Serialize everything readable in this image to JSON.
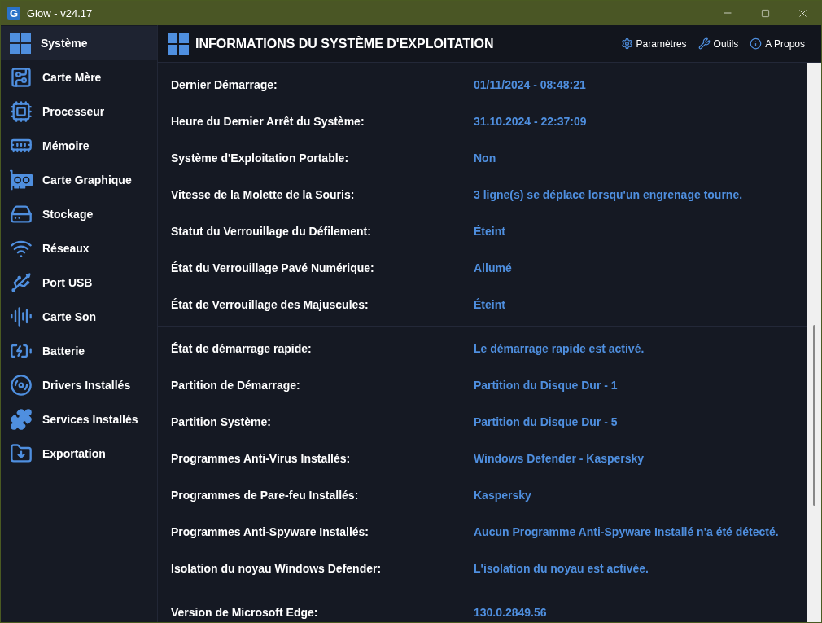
{
  "window": {
    "title": "Glow - v24.17",
    "logo": "G"
  },
  "sidebar": {
    "items": [
      {
        "label": "Système",
        "selected": true
      },
      {
        "label": "Carte Mère",
        "selected": false
      },
      {
        "label": "Processeur",
        "selected": false
      },
      {
        "label": "Mémoire",
        "selected": false
      },
      {
        "label": "Carte Graphique",
        "selected": false
      },
      {
        "label": "Stockage",
        "selected": false
      },
      {
        "label": "Réseaux",
        "selected": false
      },
      {
        "label": "Port USB",
        "selected": false
      },
      {
        "label": "Carte Son",
        "selected": false
      },
      {
        "label": "Batterie",
        "selected": false
      },
      {
        "label": "Drivers Installés",
        "selected": false
      },
      {
        "label": "Services Installés",
        "selected": false
      },
      {
        "label": "Exportation",
        "selected": false
      }
    ]
  },
  "header": {
    "title": "INFORMATIONS DU SYSTÈME D'EXPLOITATION",
    "actions": [
      "Paramètres",
      "Outils",
      "A Propos"
    ]
  },
  "sections": [
    {
      "rows": [
        {
          "label": "Dernier Démarrage:",
          "value": "01/11/2024 - 08:48:21"
        },
        {
          "label": "Heure du Dernier Arrêt du Système:",
          "value": "31.10.2024 - 22:37:09"
        },
        {
          "label": "Système d'Exploitation Portable:",
          "value": "Non"
        },
        {
          "label": "Vitesse de la Molette de la Souris:",
          "value": "3 ligne(s) se déplace lorsqu'un engrenage tourne."
        },
        {
          "label": "Statut du Verrouillage du Défilement:",
          "value": "Éteint"
        },
        {
          "label": "État du Verrouillage Pavé Numérique:",
          "value": "Allumé"
        },
        {
          "label": "État de Verrouillage des Majuscules:",
          "value": "Éteint"
        }
      ]
    },
    {
      "rows": [
        {
          "label": "État de démarrage rapide:",
          "value": "Le démarrage rapide est activé."
        },
        {
          "label": "Partition de Démarrage:",
          "value": "Partition du Disque Dur - 1"
        },
        {
          "label": "Partition Système:",
          "value": "Partition du Disque Dur - 5"
        },
        {
          "label": "Programmes Anti-Virus Installés:",
          "value": "Windows Defender - Kaspersky"
        },
        {
          "label": "Programmes de Pare-feu Installés:",
          "value": "Kaspersky"
        },
        {
          "label": "Programmes Anti-Spyware Installés:",
          "value": "Aucun Programme Anti-Spyware Installé n'a été détecté."
        },
        {
          "label": "Isolation du noyau Windows Defender:",
          "value": "L'isolation du noyau est activée."
        }
      ]
    },
    {
      "rows": [
        {
          "label": "Version de Microsoft Edge:",
          "value": "130.0.2849.56"
        }
      ]
    }
  ]
}
